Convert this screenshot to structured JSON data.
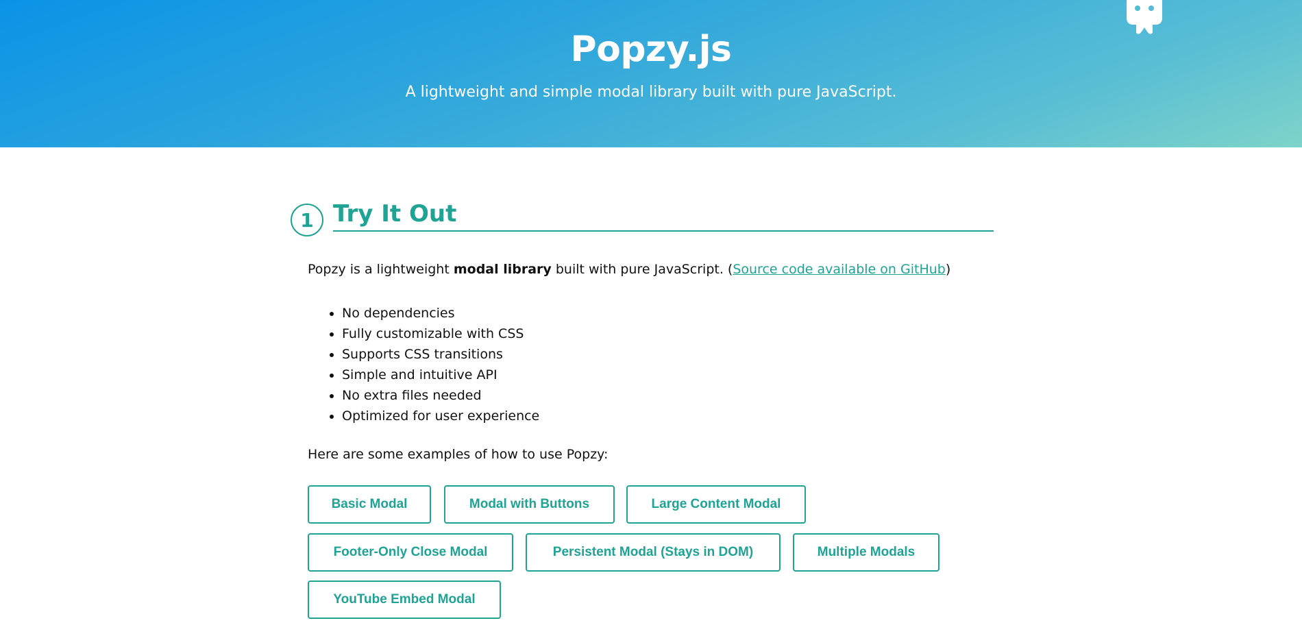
{
  "hero": {
    "title": "Popzy.js",
    "subtitle": "A lightweight and simple modal library built with pure JavaScript.",
    "mascot_icon": "robot-mascot-icon"
  },
  "section": {
    "number": "1",
    "title": "Try It Out",
    "intro": {
      "before": "Popzy is a lightweight ",
      "bold": "modal library",
      "after": " built with pure JavaScript. (",
      "link": "Source code available on GitHub",
      "close": ")"
    },
    "features": [
      "No dependencies",
      "Fully customizable with CSS",
      "Supports CSS transitions",
      "Simple and intuitive API",
      "No extra files needed",
      "Optimized for user experience"
    ],
    "examples_intro": "Here are some examples of how to use Popzy:",
    "buttons": [
      "Basic Modal",
      "Modal with Buttons",
      "Large Content Modal",
      "Footer-Only Close Modal",
      "Persistent Modal (Stays in DOM)",
      "Multiple Modals",
      "YouTube Embed Modal"
    ]
  },
  "colors": {
    "accent": "#1fa394",
    "hero_gradient_start": "#0a93e6",
    "hero_gradient_end": "#7dd3c8"
  }
}
